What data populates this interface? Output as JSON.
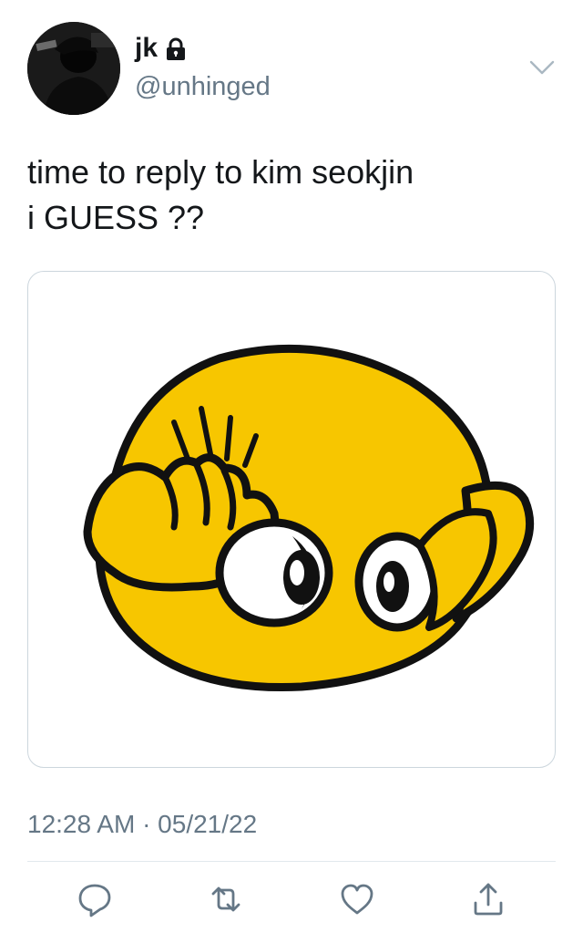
{
  "tweet": {
    "author": {
      "display_name": "jk",
      "handle": "@unhinged",
      "protected": true
    },
    "text_lines": [
      "time to reply to kim seokjin",
      "i GUESS ??"
    ],
    "timestamp": "12:28 AM · 05/21/22",
    "media": {
      "kind": "emoji-sticker",
      "description_icon": "covering-face-emoji"
    }
  },
  "icons": {
    "lock": "lock-icon",
    "menu": "chevron-down-icon",
    "reply": "reply-icon",
    "retweet": "retweet-icon",
    "like": "heart-icon",
    "share": "share-icon"
  },
  "colors": {
    "text": "#14171a",
    "secondary_text": "#657786",
    "divider": "#e1e8ed",
    "icon": "#657786",
    "emoji_yellow": "#f7c600"
  }
}
